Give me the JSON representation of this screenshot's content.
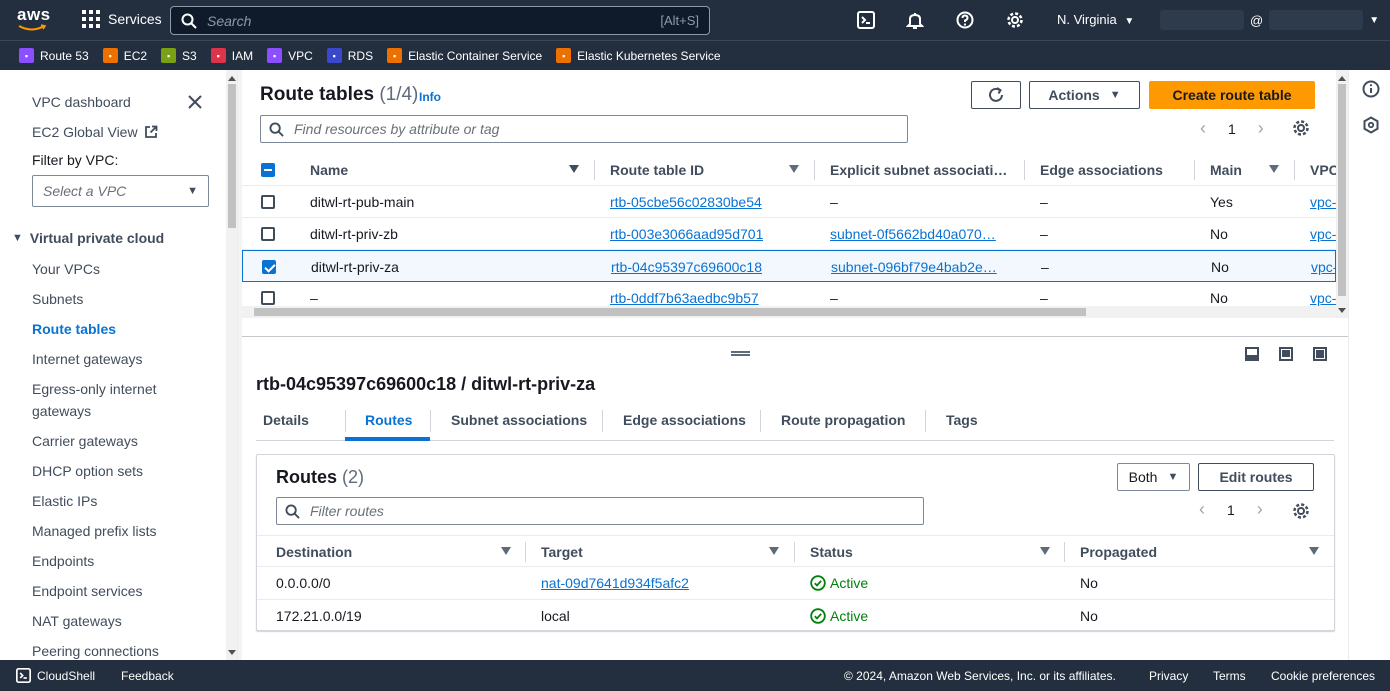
{
  "topnav": {
    "logo_text": "aws",
    "services_label": "Services",
    "search_placeholder": "Search",
    "search_shortcut": "[Alt+S]",
    "region": "N. Virginia",
    "account_at": "@"
  },
  "favorites": [
    {
      "label": "Route 53",
      "color": "#8c4fff",
      "icon": "route53-icon"
    },
    {
      "label": "EC2",
      "color": "#ed7100",
      "icon": "ec2-icon"
    },
    {
      "label": "S3",
      "color": "#7aa116",
      "icon": "s3-icon"
    },
    {
      "label": "IAM",
      "color": "#dd344c",
      "icon": "iam-icon"
    },
    {
      "label": "VPC",
      "color": "#8c4fff",
      "icon": "vpc-icon"
    },
    {
      "label": "RDS",
      "color": "#3b48cc",
      "icon": "rds-icon"
    },
    {
      "label": "Elastic Container Service",
      "color": "#ed7100",
      "icon": "ecs-icon"
    },
    {
      "label": "Elastic Kubernetes Service",
      "color": "#ed7100",
      "icon": "eks-icon"
    }
  ],
  "sidebar": {
    "dashboard": "VPC dashboard",
    "ec2_global": "EC2 Global View",
    "filter_label": "Filter by VPC:",
    "filter_placeholder": "Select a VPC",
    "section": "Virtual private cloud",
    "items": [
      "Your VPCs",
      "Subnets",
      "Route tables",
      "Internet gateways",
      "Egress-only internet",
      "gateways",
      "Carrier gateways",
      "DHCP option sets",
      "Elastic IPs",
      "Managed prefix lists",
      "Endpoints",
      "Endpoint services",
      "NAT gateways",
      "Peering connections"
    ],
    "active_item": "Route tables"
  },
  "route_tables": {
    "title": "Route tables",
    "count": "(1/4)",
    "info": "Info",
    "actions_label": "Actions",
    "create_label": "Create route table",
    "filter_placeholder": "Find resources by attribute or tag",
    "page": "1",
    "columns": [
      "Name",
      "Route table ID",
      "Explicit subnet associati…",
      "Edge associations",
      "Main",
      "VPC"
    ],
    "rows": [
      {
        "name": "ditwl-rt-pub-main",
        "id": "rtb-05cbe56c02830be54",
        "subnet": "–",
        "edge": "–",
        "main": "Yes",
        "vpc": "vpc-",
        "selected": false
      },
      {
        "name": "ditwl-rt-priv-zb",
        "id": "rtb-003e3066aad95d701",
        "subnet": "subnet-0f5662bd40a070…",
        "edge": "–",
        "main": "No",
        "vpc": "vpc-",
        "selected": false
      },
      {
        "name": "ditwl-rt-priv-za",
        "id": "rtb-04c95397c69600c18",
        "subnet": "subnet-096bf79e4bab2e…",
        "edge": "–",
        "main": "No",
        "vpc": "vpc-",
        "selected": true
      },
      {
        "name": "–",
        "id": "rtb-0ddf7b63aedbc9b57",
        "subnet": "–",
        "edge": "–",
        "main": "No",
        "vpc": "vpc-",
        "selected": false
      }
    ]
  },
  "detail": {
    "title": "rtb-04c95397c69600c18 / ditwl-rt-priv-za",
    "tabs": [
      "Details",
      "Routes",
      "Subnet associations",
      "Edge associations",
      "Route propagation",
      "Tags"
    ],
    "active_tab": "Routes",
    "routes": {
      "title": "Routes",
      "count": "(2)",
      "filter_select": "Both",
      "edit_label": "Edit routes",
      "filter_placeholder": "Filter routes",
      "page": "1",
      "columns": [
        "Destination",
        "Target",
        "Status",
        "Propagated"
      ],
      "rows": [
        {
          "destination": "0.0.0.0/0",
          "target": "nat-09d7641d934f5afc2",
          "target_link": true,
          "status": "Active",
          "propagated": "No"
        },
        {
          "destination": "172.21.0.0/19",
          "target": "local",
          "target_link": false,
          "status": "Active",
          "propagated": "No"
        }
      ]
    }
  },
  "footer": {
    "cloudshell": "CloudShell",
    "feedback": "Feedback",
    "copyright": "© 2024, Amazon Web Services, Inc. or its affiliates.",
    "privacy": "Privacy",
    "terms": "Terms",
    "cookies": "Cookie preferences"
  },
  "colors": {
    "nav_bg": "#232f3e",
    "link": "#0972d3",
    "primary_button": "#ff9900",
    "success": "#037f0c"
  }
}
